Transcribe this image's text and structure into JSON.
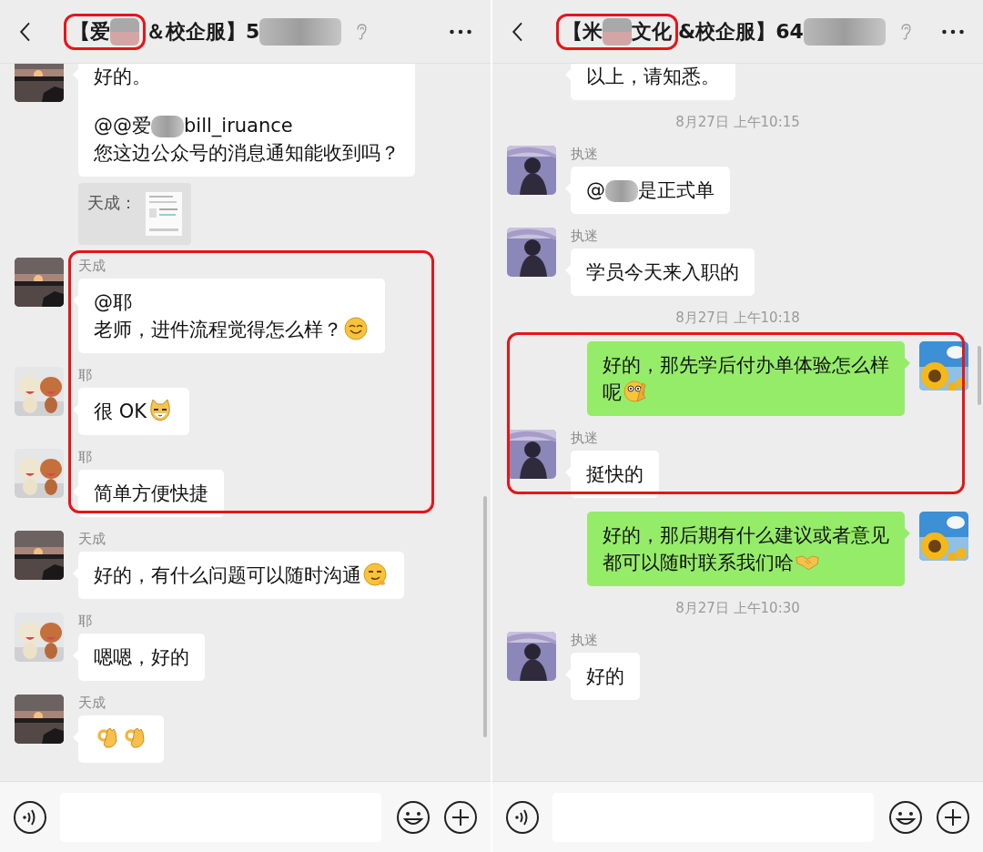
{
  "panels": [
    {
      "title": {
        "parts": [
          {
            "kind": "text",
            "text": "【爱",
            "circled": true
          },
          {
            "kind": "blur",
            "circled": true
          },
          {
            "kind": "text",
            "text": "＆校企服】5",
            "circled": false
          },
          {
            "kind": "blur",
            "circled": false
          }
        ]
      },
      "messages": [
        {
          "kind": "text",
          "self": false,
          "avatar": true,
          "highlighted": false,
          "lines": [
            {
              "kind": "text",
              "parts": [
                {
                  "kind": "text",
                  "text": "好的。"
                }
              ]
            },
            {
              "kind": "blank"
            },
            {
              "kind": "text",
              "parts": [
                {
                  "kind": "text",
                  "text": "@@爱"
                },
                {
                  "kind": "blur"
                },
                {
                  "kind": "text",
                  "text": "bill_iruance"
                }
              ]
            },
            {
              "kind": "text",
              "parts": [
                {
                  "kind": "text",
                  "text": "您这边公众号的消息通知能收到吗？"
                }
              ]
            }
          ]
        },
        {
          "kind": "quote",
          "text": "天成：",
          "highlighted": false
        },
        {
          "kind": "text",
          "self": false,
          "avatar": true,
          "sender": "天成",
          "highlighted": true,
          "lines": [
            {
              "parts": [
                {
                  "kind": "text",
                  "text": "@耶"
                }
              ]
            },
            {
              "parts": [
                {
                  "kind": "text",
                  "text": "老师，进件流程觉得怎么样？"
                },
                {
                  "kind": "emoji"
                }
              ]
            }
          ]
        },
        {
          "kind": "text",
          "self": false,
          "avatar": true,
          "sender": "耶",
          "highlighted": true,
          "lines": [
            {
              "parts": [
                {
                  "kind": "text",
                  "text": "很 OK"
                },
                {
                  "kind": "emoji"
                }
              ]
            }
          ]
        },
        {
          "kind": "text",
          "self": false,
          "avatar": true,
          "sender": "耶",
          "highlighted": true,
          "lines": [
            {
              "parts": [
                {
                  "kind": "text",
                  "text": "简单方便快捷"
                }
              ]
            }
          ]
        },
        {
          "kind": "text",
          "self": false,
          "avatar": true,
          "sender": "天成",
          "highlighted": false,
          "lines": [
            {
              "parts": [
                {
                  "kind": "text",
                  "text": "好的，有什么问题可以随时沟通"
                },
                {
                  "kind": "emoji"
                }
              ]
            }
          ]
        },
        {
          "kind": "text",
          "self": false,
          "avatar": true,
          "sender": "耶",
          "highlighted": false,
          "lines": [
            {
              "parts": [
                {
                  "kind": "text",
                  "text": "嗯嗯，好的"
                }
              ]
            }
          ]
        },
        {
          "kind": "text",
          "self": false,
          "avatar": true,
          "sender": "天成",
          "highlighted": false,
          "lines": [
            {
              "parts": [
                {
                  "kind": "emoji"
                },
                {
                  "kind": "emoji"
                }
              ]
            }
          ]
        }
      ]
    },
    {
      "title": {
        "parts": [
          {
            "kind": "text",
            "text": "【米",
            "circled": true
          },
          {
            "kind": "blur",
            "circled": true
          },
          {
            "kind": "text",
            "text": "文化",
            "circled": true
          },
          {
            "kind": "text",
            "text": "&校企服】64",
            "circled": false
          },
          {
            "kind": "blur",
            "circled": false
          }
        ]
      },
      "messages": [
        {
          "kind": "text",
          "self": false,
          "avatar": false,
          "highlighted": false,
          "lines": [
            {
              "parts": [
                {
                  "kind": "text",
                  "text": "以上，请知悉。"
                }
              ]
            }
          ]
        },
        {
          "kind": "time",
          "text": "8月27日 上午10:15",
          "highlighted": false
        },
        {
          "kind": "text",
          "self": false,
          "avatar": true,
          "sender": "执迷",
          "highlighted": false,
          "lines": [
            {
              "parts": [
                {
                  "kind": "text",
                  "text": "@"
                },
                {
                  "kind": "blur"
                },
                {
                  "kind": "text",
                  "text": "是正式单"
                }
              ]
            }
          ]
        },
        {
          "kind": "text",
          "self": false,
          "avatar": true,
          "sender": "执迷",
          "highlighted": false,
          "lines": [
            {
              "parts": [
                {
                  "kind": "text",
                  "text": "学员今天来入职的"
                }
              ]
            }
          ]
        },
        {
          "kind": "time",
          "text": "8月27日 上午10:18",
          "highlighted": false
        },
        {
          "kind": "text",
          "self": true,
          "avatar": true,
          "highlighted": true,
          "lines": [
            {
              "parts": [
                {
                  "kind": "text",
                  "text": "好的，那先学后付办单体验怎么样"
                }
              ]
            },
            {
              "parts": [
                {
                  "kind": "text",
                  "text": "呢"
                },
                {
                  "kind": "emoji"
                }
              ]
            }
          ]
        },
        {
          "kind": "text",
          "self": false,
          "avatar": true,
          "sender": "执迷",
          "highlighted": true,
          "lines": [
            {
              "parts": [
                {
                  "kind": "text",
                  "text": "挺快的"
                }
              ]
            }
          ]
        },
        {
          "kind": "text",
          "self": true,
          "avatar": true,
          "highlighted": false,
          "lines": [
            {
              "parts": [
                {
                  "kind": "text",
                  "text": "好的，那后期有什么建议或者意见"
                }
              ]
            },
            {
              "parts": [
                {
                  "kind": "text",
                  "text": "都可以随时联系我们哈"
                },
                {
                  "kind": "emoji"
                }
              ]
            }
          ]
        },
        {
          "kind": "time",
          "text": "8月27日 上午10:30",
          "highlighted": false
        },
        {
          "kind": "text",
          "self": false,
          "avatar": true,
          "sender": "执迷",
          "highlighted": false,
          "lines": [
            {
              "parts": [
                {
                  "kind": "text",
                  "text": "好的"
                }
              ]
            }
          ]
        }
      ]
    }
  ]
}
